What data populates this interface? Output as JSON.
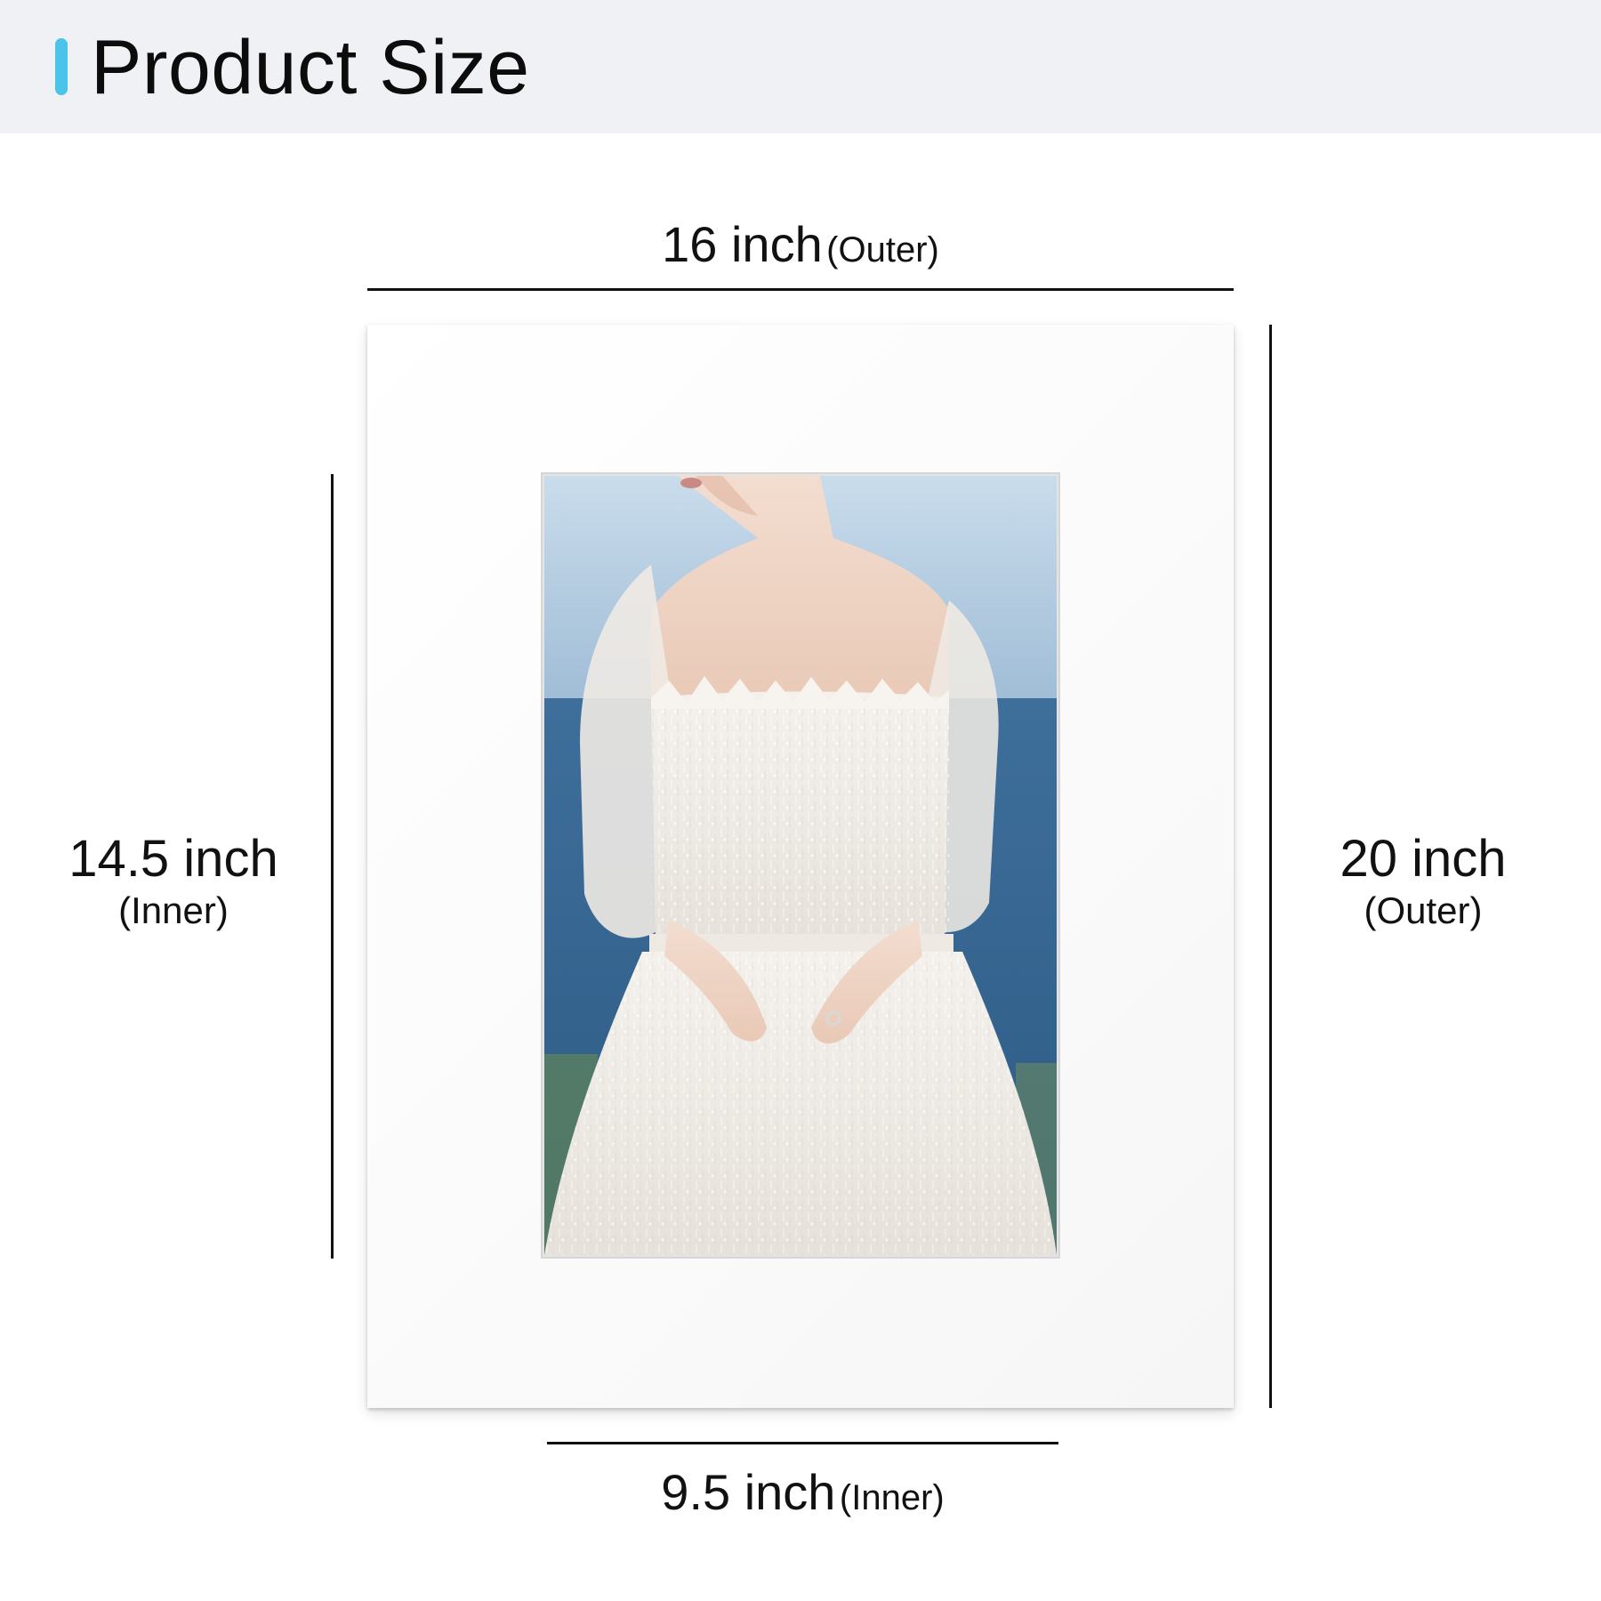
{
  "header": {
    "title": "Product Size"
  },
  "dimensions": {
    "top": {
      "value": "16 inch",
      "note": "(Outer)"
    },
    "bottom": {
      "value": "9.5 inch",
      "note": "(Inner)"
    },
    "left": {
      "value": "14.5 inch",
      "note": "(Inner)"
    },
    "right": {
      "value": "20 inch",
      "note": "(Outer)"
    }
  },
  "colors": {
    "accent": "#4cc3e8",
    "header_background": "#f0f1f4",
    "line": "#111111"
  },
  "image": {
    "subject": "bride-in-lace-wedding-dress-photo"
  }
}
